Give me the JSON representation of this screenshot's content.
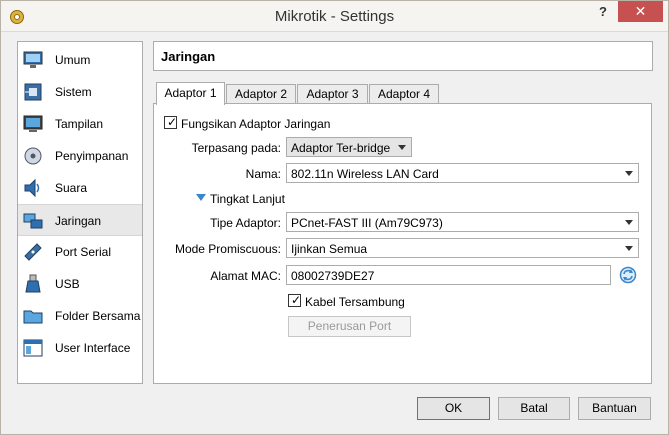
{
  "window": {
    "title": "Mikrotik - Settings",
    "help_label": "?",
    "close_label": "✕"
  },
  "sidebar": {
    "items": [
      {
        "label": "Umum",
        "icon": "monitor-general-icon"
      },
      {
        "label": "Sistem",
        "icon": "motherboard-icon"
      },
      {
        "label": "Tampilan",
        "icon": "display-icon"
      },
      {
        "label": "Penyimpanan",
        "icon": "disk-icon"
      },
      {
        "label": "Suara",
        "icon": "speaker-icon"
      },
      {
        "label": "Jaringan",
        "icon": "network-icon"
      },
      {
        "label": "Port Serial",
        "icon": "serial-port-icon"
      },
      {
        "label": "USB",
        "icon": "usb-icon"
      },
      {
        "label": "Folder Bersama",
        "icon": "folder-icon"
      },
      {
        "label": "User Interface",
        "icon": "user-interface-icon"
      }
    ],
    "selected": "Jaringan"
  },
  "header": {
    "title": "Jaringan"
  },
  "tabs": [
    "Adaptor 1",
    "Adaptor 2",
    "Adaptor 3",
    "Adaptor 4"
  ],
  "form": {
    "enable_adapter_label": "Fungsikan Adaptor Jaringan",
    "attached_to_label": "Terpasang pada:",
    "attached_to_value": "Adaptor Ter-bridge",
    "name_label": "Nama:",
    "name_value": "802.11n Wireless LAN Card",
    "advanced_label": "Tingkat Lanjut",
    "adapter_type_label": "Tipe Adaptor:",
    "adapter_type_value": "PCnet-FAST III (Am79C973)",
    "promiscuous_label": "Mode Promiscuous:",
    "promiscuous_value": "Ijinkan Semua",
    "mac_label": "Alamat MAC:",
    "mac_value": "08002739DE27",
    "cable_label": "Kabel Tersambung",
    "port_forward_label": "Penerusan Port"
  },
  "buttons": {
    "ok": "OK",
    "cancel": "Batal",
    "help": "Bantuan"
  },
  "colors": {
    "close_button": "#c75050",
    "accent_blue": "#3a86c8"
  }
}
